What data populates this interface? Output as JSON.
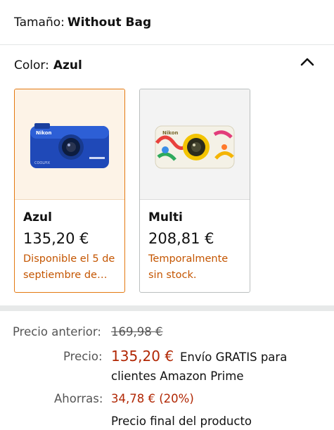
{
  "size": {
    "label": "Tamaño:",
    "value": "Without Bag"
  },
  "color": {
    "label": "Color:",
    "value": "Azul"
  },
  "options": [
    {
      "name": "Azul",
      "price": "135,20 €",
      "availability_line1": "Disponible el 5 de",
      "availability_line2": "septiembre de…",
      "brand_text": "Nikon",
      "model_text": "COOLPIX"
    },
    {
      "name": "Multi",
      "price": "208,81 €",
      "availability_line1": "Temporalmente",
      "availability_line2": "sin stock.",
      "brand_text": "Nikon"
    }
  ],
  "pricing": {
    "previous_label": "Precio anterior:",
    "previous_value": "169,98 €",
    "price_label": "Precio:",
    "price_value": "135,20 €",
    "shipping_line1": "Envío GRATIS para",
    "shipping_line2": "clientes Amazon Prime",
    "savings_label": "Ahorras:",
    "savings_value": "34,78 € (20%)",
    "final_text": "Precio final del producto"
  },
  "colors": {
    "accent_orange": "#e47911",
    "price_red": "#b12704",
    "availability_orange": "#c45500"
  },
  "icons": {
    "collapse": "chevron-up-icon"
  }
}
